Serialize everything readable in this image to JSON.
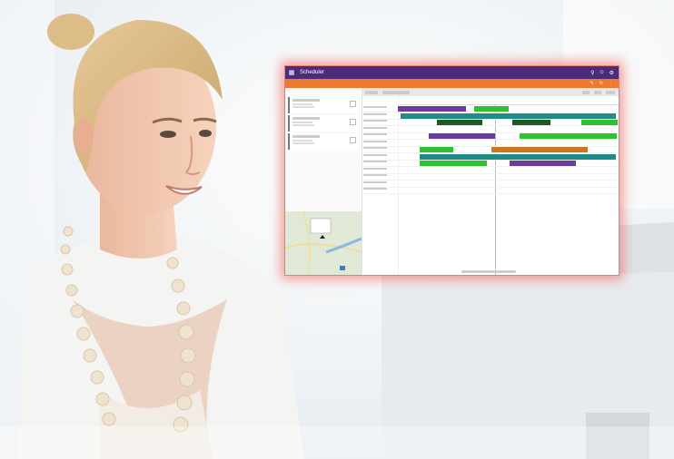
{
  "colors": {
    "app_bar": "#4a2c7a",
    "sub_bar": "#ef7a2f",
    "screen_glow": "#f05046",
    "bar_purple": "#6a3d9a",
    "bar_teal": "#1f8c87",
    "bar_green": "#2fc12f",
    "bar_darkgreen": "#1e5a22",
    "bar_orange": "#c8781e",
    "now_line": "#f0a0a8"
  },
  "screen": {
    "app_title": "Scheduler",
    "app_icon": "grid-menu-icon",
    "header_icons": [
      "search-icon",
      "add-user-icon",
      "settings-icon"
    ],
    "subbar_icons": [
      "edit-icon",
      "refresh-icon",
      "more-icon"
    ],
    "resource_count": 13,
    "requirement_count": 3,
    "booking_count": 13
  }
}
